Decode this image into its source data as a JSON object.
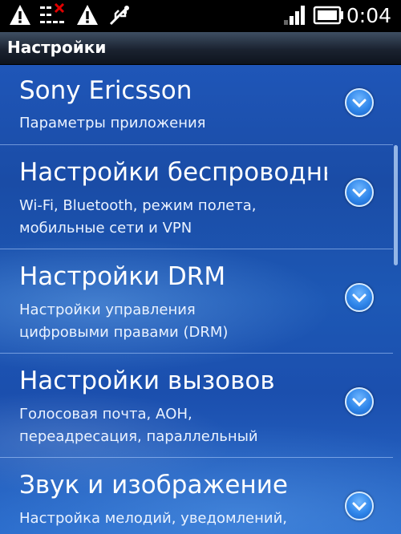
{
  "status_bar": {
    "time": "0:04",
    "icons": [
      "warning-icon",
      "no-network-data-icon",
      "warning-icon",
      "usb-icon",
      "signal-icon",
      "battery-icon"
    ]
  },
  "header": {
    "title": "Настройки"
  },
  "list": {
    "items": [
      {
        "title": "Sony Ericsson",
        "subtitle": [
          "Параметры приложения"
        ]
      },
      {
        "title": "Настройки беспроводных",
        "subtitle": [
          "Wi-Fi, Bluetooth, режим полета,",
          "мобильные сети и VPN"
        ]
      },
      {
        "title": "Настройки DRM",
        "subtitle": [
          "Настройки управления",
          "цифровыми правами (DRM)"
        ]
      },
      {
        "title": "Настройки вызовов",
        "subtitle": [
          "Голосовая почта, АОН,",
          "переадресация, параллельный"
        ]
      },
      {
        "title": "Звук и изображение",
        "subtitle": [
          "Настройка мелодий, уведомлений,"
        ]
      }
    ]
  },
  "colors": {
    "status_bar_bg": "#000000",
    "title_bar_bg": "#1a2230",
    "list_bg": "#1d58b5",
    "expand_button": "#2f86ea"
  }
}
